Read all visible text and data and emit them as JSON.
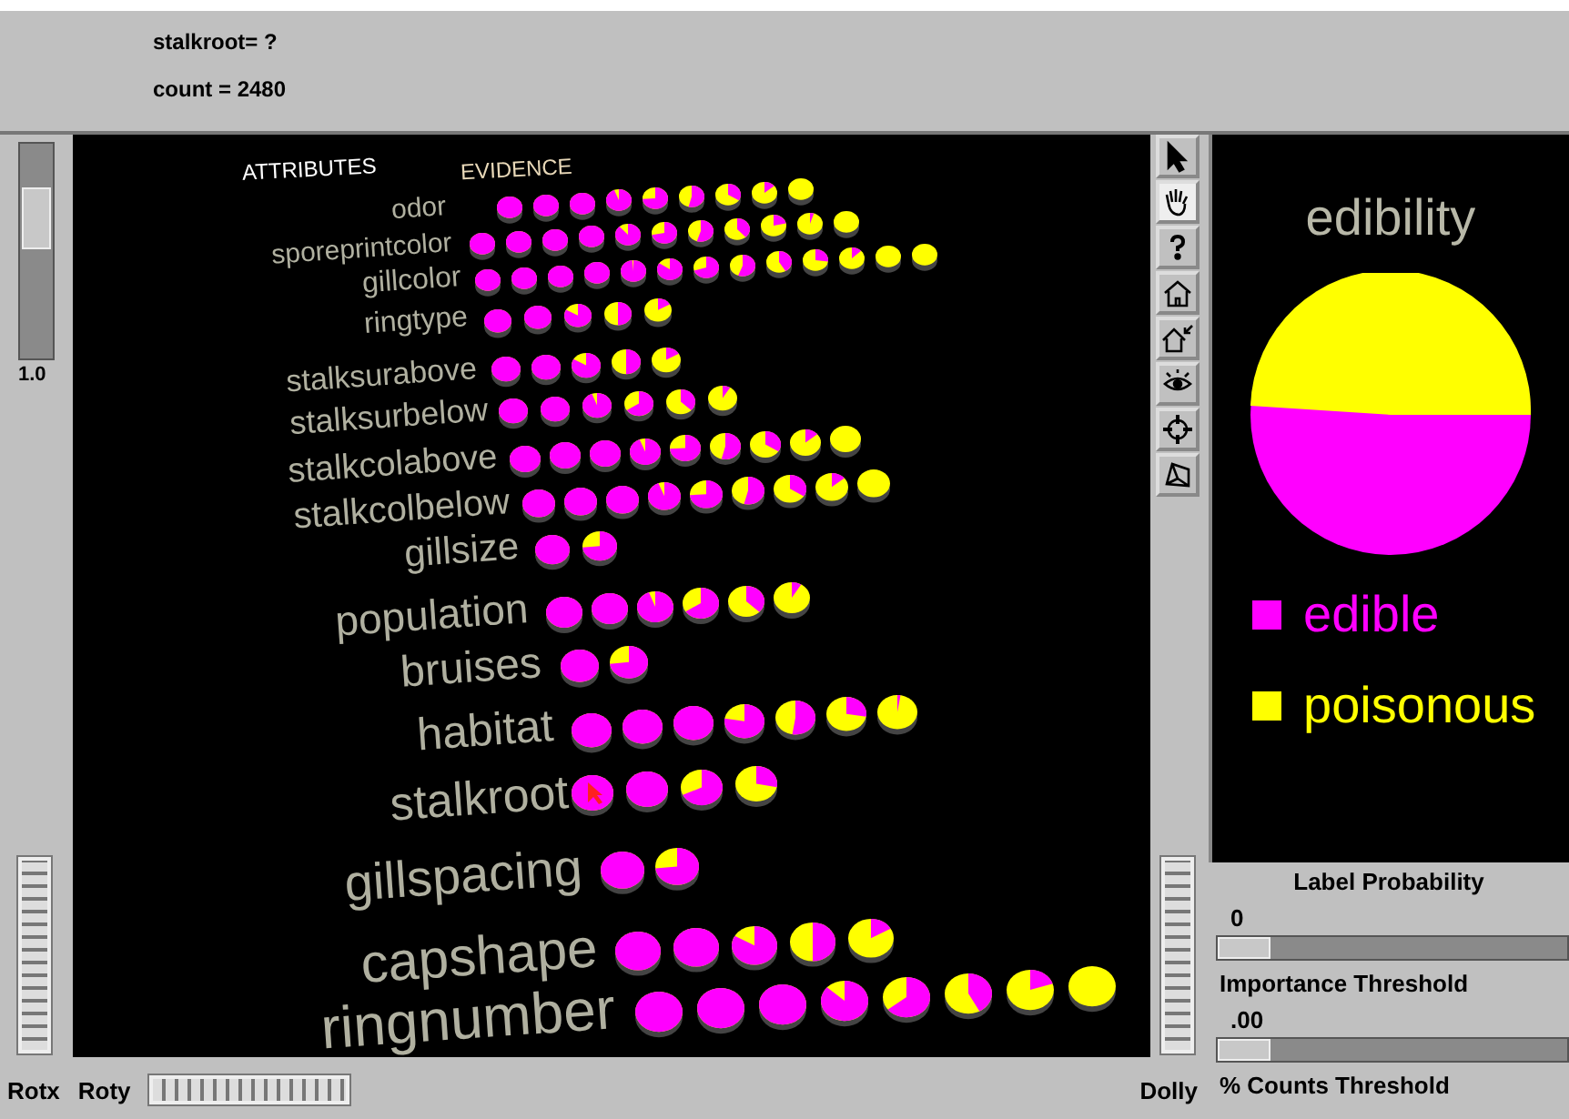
{
  "status": {
    "lines": [
      "stalkroot= ?",
      "count = 2480"
    ]
  },
  "viewer": {
    "header": [
      "ATTRIBUTES",
      "EVIDENCE"
    ],
    "attributes": [
      "odor",
      "sporeprintcolor",
      "gillcolor",
      "ringtype",
      "stalksurabove",
      "stalksurbelow",
      "stalkcolabove",
      "stalkcolbelow",
      "gillsize",
      "population",
      "bruises",
      "habitat",
      "stalkroot",
      "gillspacing",
      "capshape",
      "ringnumber"
    ],
    "left_slider": {
      "level": 0.72,
      "reading": "1.0"
    },
    "wheels": {
      "rotx": "Rotx",
      "roty": "Roty",
      "dolly": "Dolly"
    },
    "tools": [
      {
        "kind": "pointer",
        "selected": false
      },
      {
        "kind": "hand",
        "selected": true
      },
      {
        "kind": "help",
        "selected": false
      },
      {
        "kind": "home",
        "selected": false
      },
      {
        "kind": "sethome",
        "selected": false
      },
      {
        "kind": "viewall",
        "selected": false
      },
      {
        "kind": "seek",
        "selected": false
      },
      {
        "kind": "perspective",
        "selected": false
      }
    ]
  },
  "label_panel": {
    "title": "edibility",
    "classes": [
      {
        "label": "edible",
        "color": "#ff00ff"
      },
      {
        "label": "poisonous",
        "color": "#ffff00"
      }
    ],
    "controls": [
      {
        "label": "Label Probability",
        "value": "0",
        "level": 0.05
      },
      {
        "label": "Importance Threshold",
        "value": ".00",
        "level": 0.05
      },
      {
        "label": "% Counts Threshold"
      }
    ]
  }
}
